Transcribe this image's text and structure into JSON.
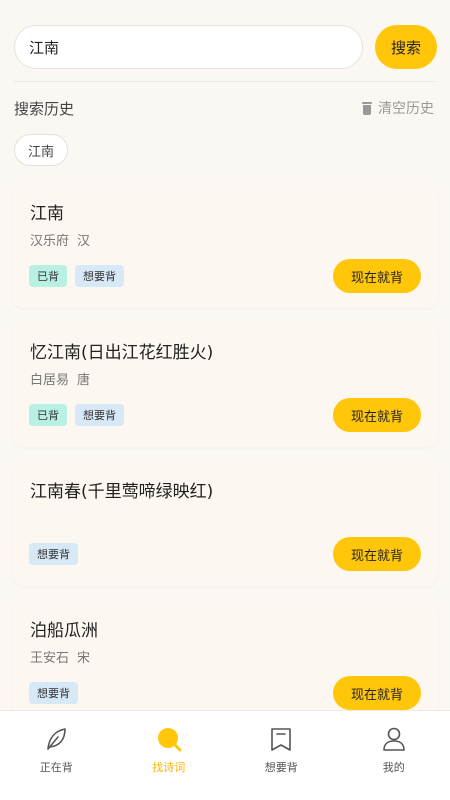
{
  "search": {
    "value": "江南",
    "button_label": "搜索"
  },
  "history": {
    "title": "搜索历史",
    "clear_label": "清空历史",
    "items": [
      "江南"
    ]
  },
  "results": [
    {
      "title": "江南",
      "author": "汉乐府",
      "dynasty": "汉",
      "tags": [
        "已背",
        "想要背"
      ],
      "action_label": "现在就背"
    },
    {
      "title": "忆江南(日出江花红胜火)",
      "author": "白居易",
      "dynasty": "唐",
      "tags": [
        "已背",
        "想要背"
      ],
      "action_label": "现在就背"
    },
    {
      "title": "江南春(千里莺啼绿映红)",
      "author": "",
      "dynasty": "",
      "tags": [
        "想要背"
      ],
      "action_label": "现在就背"
    },
    {
      "title": "泊船瓜洲",
      "author": "王安石",
      "dynasty": "宋",
      "tags": [
        "想要背"
      ],
      "action_label": "现在就背"
    }
  ],
  "tabbar": {
    "tabs": [
      {
        "label": "正在背",
        "icon": "leaf-icon",
        "active": false
      },
      {
        "label": "找诗词",
        "icon": "search-icon",
        "active": true
      },
      {
        "label": "想要背",
        "icon": "bookmark-icon",
        "active": false
      },
      {
        "label": "我的",
        "icon": "user-icon",
        "active": false
      }
    ]
  },
  "colors": {
    "accent": "#ffc60a",
    "tag_done": "#b9f0e4",
    "tag_want": "#d7e8f6",
    "active_tab": "#f6b400"
  }
}
